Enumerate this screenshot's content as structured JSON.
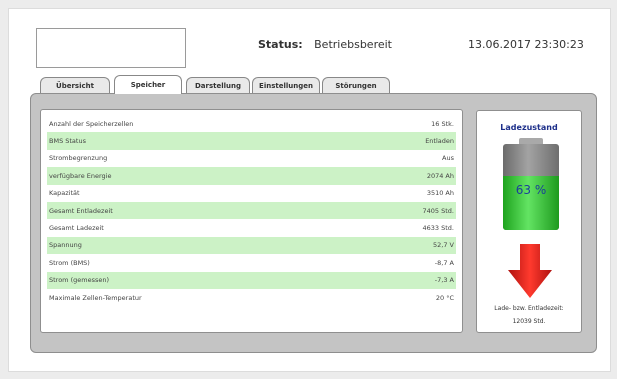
{
  "header": {
    "status_label": "Status:",
    "status_value": "Betriebsbereit",
    "datetime": "13.06.2017 23:30:23"
  },
  "tabs": [
    {
      "label": "Übersicht",
      "active": false
    },
    {
      "label": "Speicher",
      "active": true
    },
    {
      "label": "Darstellung",
      "active": false
    },
    {
      "label": "Einstellungen",
      "active": false
    },
    {
      "label": "Störungen",
      "active": false
    }
  ],
  "table": {
    "rows": [
      {
        "label": "Anzahl der Speicherzellen",
        "value": "16 Stk."
      },
      {
        "label": "BMS Status",
        "value": "Entladen"
      },
      {
        "label": "Strombegrenzung",
        "value": "Aus"
      },
      {
        "label": "verfügbare Energie",
        "value": "2074 Ah"
      },
      {
        "label": "Kapazität",
        "value": "3510 Ah"
      },
      {
        "label": "Gesamt Entladezeit",
        "value": "7405 Std."
      },
      {
        "label": "Gesamt Ladezeit",
        "value": "4633 Std."
      },
      {
        "label": "Spannung",
        "value": "52,7 V"
      },
      {
        "label": "Strom (BMS)",
        "value": "-8,7 A"
      },
      {
        "label": "Strom (gemessen)",
        "value": "-7,3 A"
      },
      {
        "label": "Maximale Zellen-Temperatur",
        "value": "20 °C"
      }
    ]
  },
  "charge": {
    "title": "Ladezustand",
    "percent_text": "63 %",
    "level": 0.63,
    "direction_icon": "down-arrow-icon",
    "caption_line1": "Lade- bzw. Entladezeit:",
    "caption_line2": "12039 Std."
  },
  "colors": {
    "row_alt": "#ccf2c6",
    "battery_fill": "#3cc83c",
    "arrow": "#e8231f",
    "title": "#1d2f8a"
  }
}
